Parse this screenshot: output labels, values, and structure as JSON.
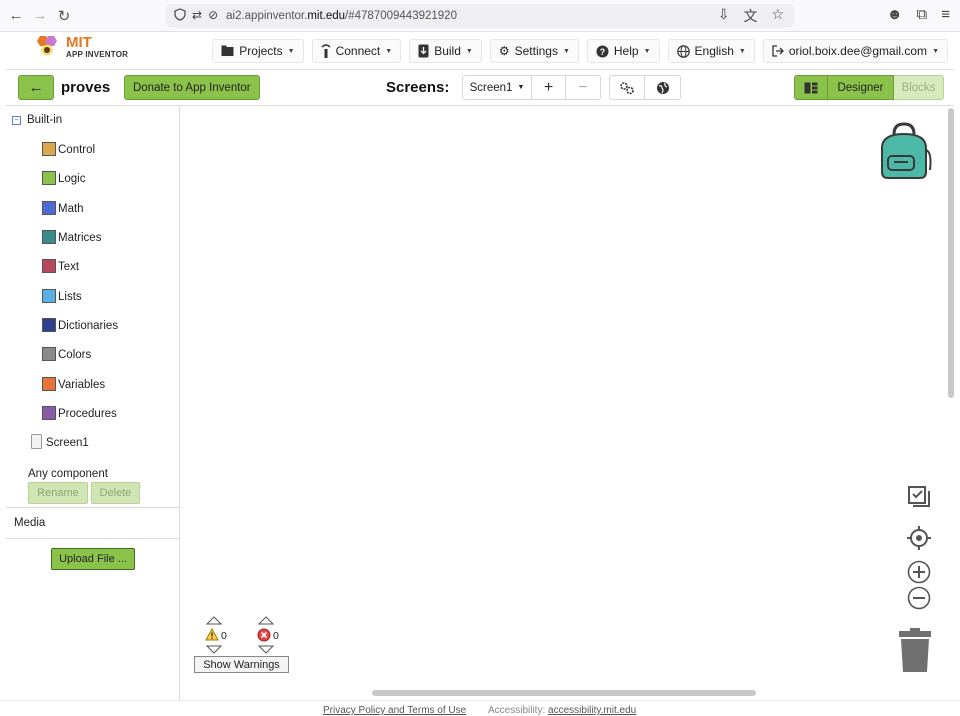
{
  "browser": {
    "url_prefix": "ai2.appinventor.",
    "url_domain": "mit.edu",
    "url_suffix": "/#4787009443921920"
  },
  "logo": {
    "line1": "MIT",
    "line2": "APP INVENTOR"
  },
  "menu": [
    {
      "label": "Projects",
      "icon": "folder-icon"
    },
    {
      "label": "Connect",
      "icon": "antenna-icon"
    },
    {
      "label": "Build",
      "icon": "build-icon"
    },
    {
      "label": "Settings",
      "icon": "gear-icon"
    },
    {
      "label": "Help",
      "icon": "help-icon"
    },
    {
      "label": "English",
      "icon": "globe-icon"
    },
    {
      "label": "oriol.boix.dee@gmail.com",
      "icon": "logout-icon"
    }
  ],
  "project": {
    "name": "proves",
    "donate_label": "Donate to App Inventor",
    "screens_label": "Screens:",
    "current_screen": "Screen1",
    "add_label": "+",
    "remove_label": "−",
    "designer_label": "Designer",
    "blocks_label": "Blocks"
  },
  "palette": {
    "builtin_label": "Built-in",
    "categories": [
      {
        "label": "Control",
        "color": "#d9a84a"
      },
      {
        "label": "Logic",
        "color": "#8bc34a"
      },
      {
        "label": "Math",
        "color": "#4a6cd4"
      },
      {
        "label": "Matrices",
        "color": "#3a8a8c"
      },
      {
        "label": "Text",
        "color": "#b5485a"
      },
      {
        "label": "Lists",
        "color": "#59b0e0"
      },
      {
        "label": "Dictionaries",
        "color": "#2d3f8e"
      },
      {
        "label": "Colors",
        "color": "#8a8a8a"
      },
      {
        "label": "Variables",
        "color": "#e8743b"
      },
      {
        "label": "Procedures",
        "color": "#8a5aa8"
      }
    ],
    "screen_item": "Screen1",
    "any_component": "Any component",
    "rename_label": "Rename",
    "delete_label": "Delete",
    "media_label": "Media",
    "upload_label": "Upload File ..."
  },
  "warnings": {
    "warning_count": "0",
    "error_count": "0",
    "show_warnings_label": "Show Warnings"
  },
  "footer": {
    "privacy": "Privacy Policy and Terms of Use",
    "accessibility_prefix": "Accessibility:",
    "accessibility_link": "accessibility.mit.edu"
  }
}
